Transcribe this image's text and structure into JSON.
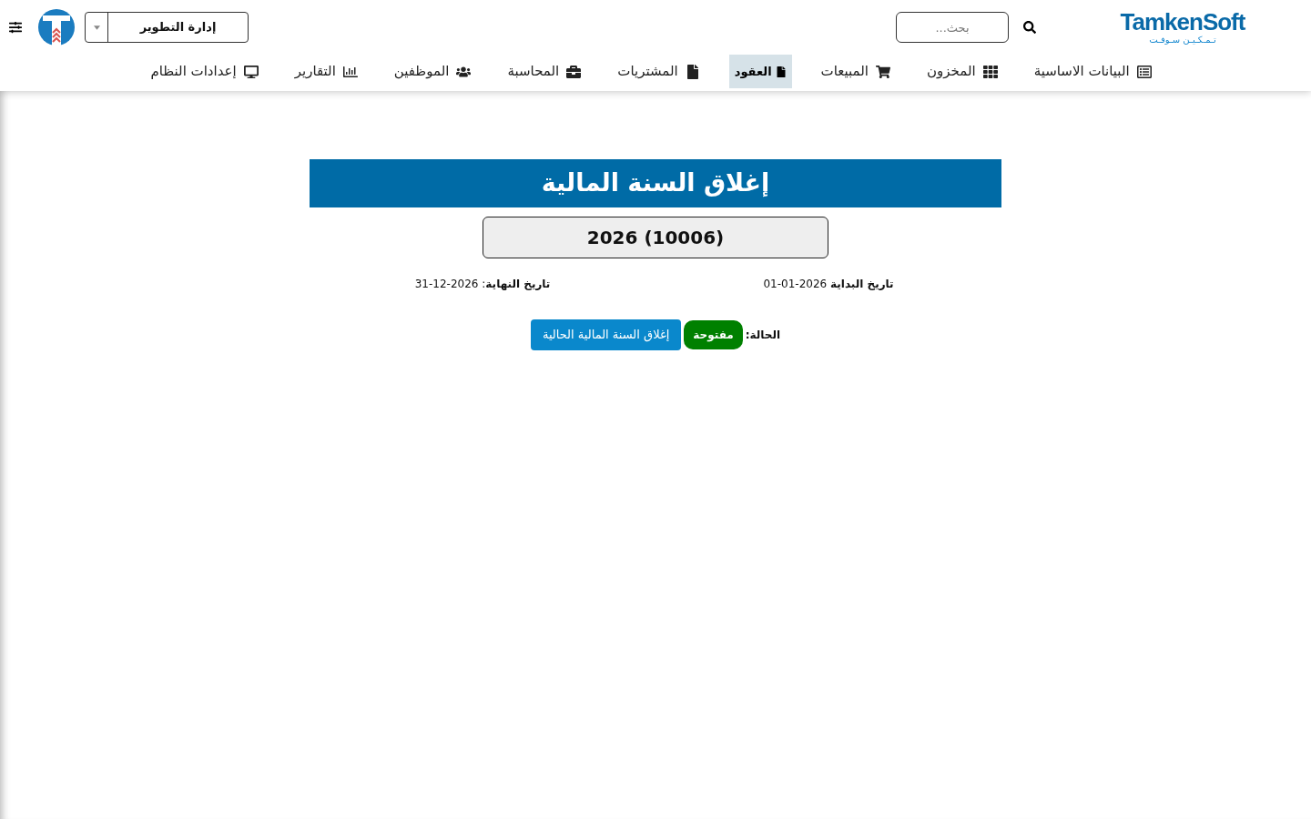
{
  "header": {
    "logo": {
      "name": "TamkenSoft",
      "tagline": "تـمـكـيـن سـوفـت"
    },
    "search": {
      "placeholder": "بحث..."
    },
    "department_select": {
      "value": "إدارة التطوير"
    }
  },
  "nav": [
    {
      "label": "البيانات الاساسية",
      "selected": false
    },
    {
      "label": "المخزون",
      "selected": false
    },
    {
      "label": "المبيعات",
      "selected": false
    },
    {
      "label": "العقود",
      "selected": true
    },
    {
      "label": "المشتريات",
      "selected": false
    },
    {
      "label": "المحاسبة",
      "selected": false
    },
    {
      "label": "الموظفين",
      "selected": false
    },
    {
      "label": "التقارير",
      "selected": false
    },
    {
      "label": "إعدادات النظام",
      "selected": false
    }
  ],
  "page": {
    "title": "إغلاق السنة المالية",
    "fiscal_year": "2026 (10006)",
    "start_date": "**تاريخ البداية** 2026-01-01",
    "end_date": "**تاريخ النهاية**: 2026-12-31",
    "status_label": "الحالة:",
    "status": "مفتوحة",
    "close_button": "إغلاق السنة المالية الحالية"
  }
}
